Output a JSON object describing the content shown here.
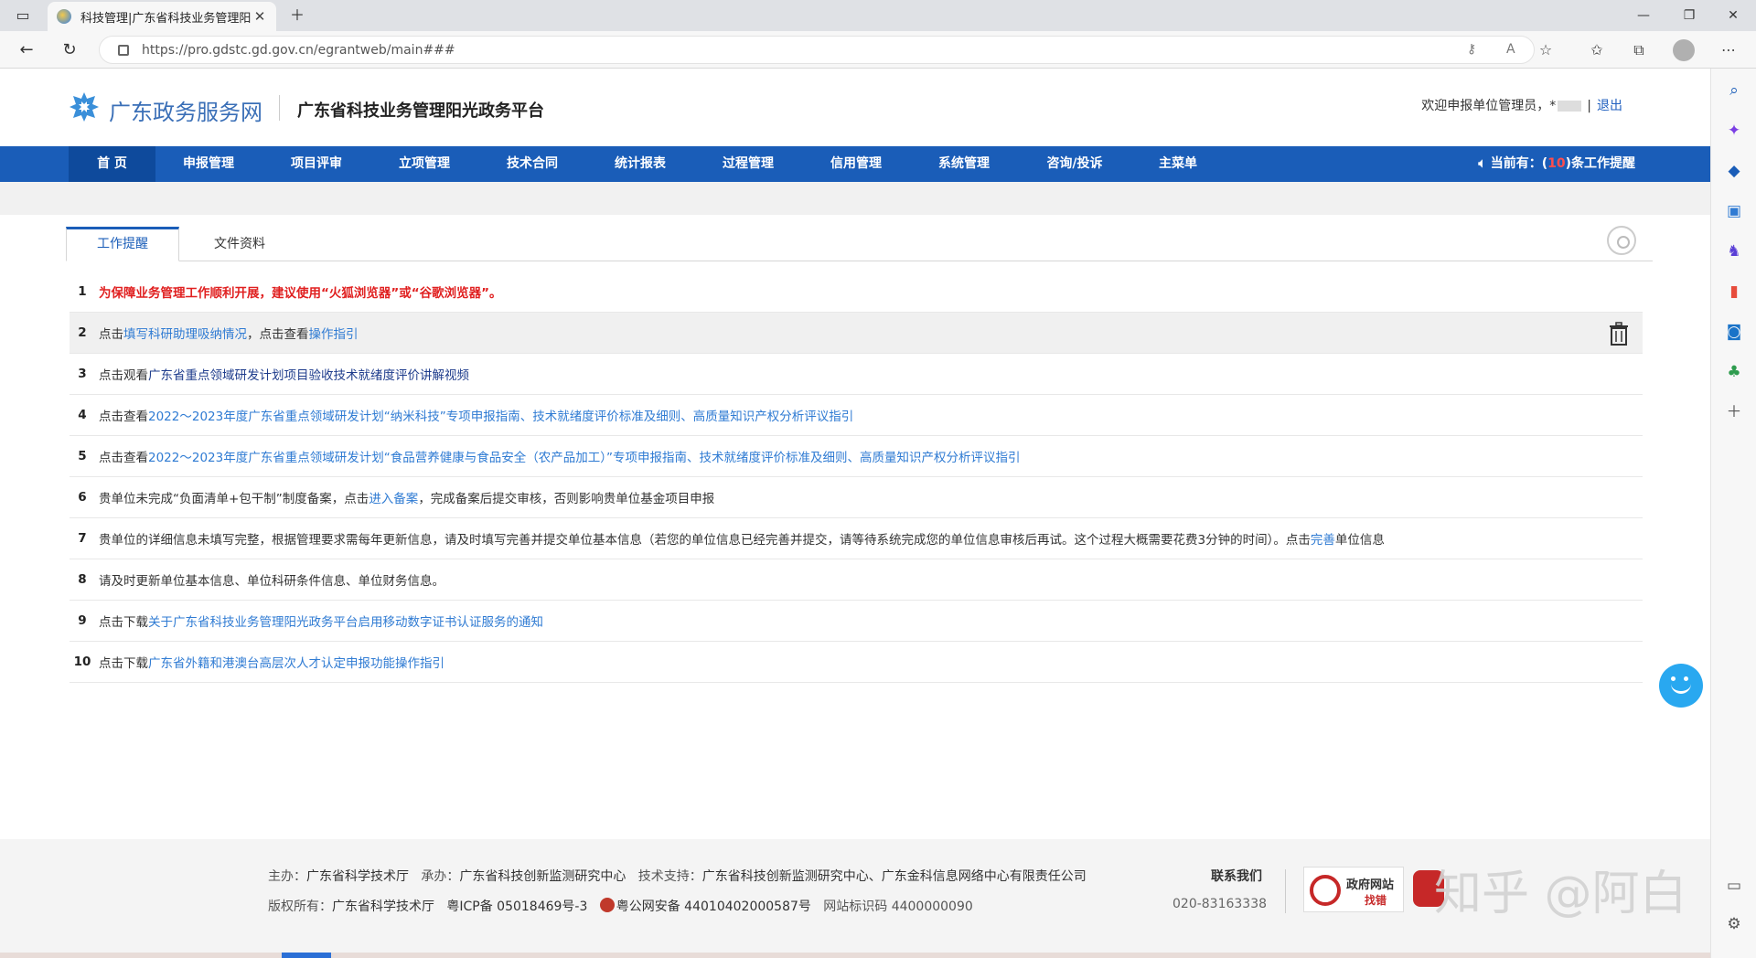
{
  "browser": {
    "tab_title": "科技管理|广东省科技业务管理阳",
    "url": "https://pro.gdstc.gd.gov.cn/egrantweb/main###"
  },
  "header": {
    "gov_logo_text": "广东政务服务网",
    "platform_title": "广东省科技业务管理阳光政务平台",
    "welcome_text": "欢迎申报单位管理员，",
    "user_mask_prefix": "*",
    "logout_label": "退出"
  },
  "nav": {
    "items": [
      "首 页",
      "申报管理",
      "项目评审",
      "立项管理",
      "技术合同",
      "统计报表",
      "过程管理",
      "信用管理",
      "系统管理",
      "咨询/投诉",
      "主菜单"
    ],
    "reminder_prefix": "当前有：(",
    "reminder_count": "10",
    "reminder_suffix": ")条工作提醒"
  },
  "page_tabs": [
    "工作提醒",
    "文件资料"
  ],
  "reminders": [
    {
      "num": "1",
      "parts": [
        {
          "t": "为保障业务管理工作顺利开展，建议使用“火狐浏览器”或“谷歌浏览器”。",
          "s": "warn"
        }
      ]
    },
    {
      "num": "2",
      "parts": [
        {
          "t": "点击",
          "s": ""
        },
        {
          "t": "填写科研助理吸纳情况",
          "s": "link"
        },
        {
          "t": "，点击查看",
          "s": ""
        },
        {
          "t": "操作指引",
          "s": "link"
        }
      ]
    },
    {
      "num": "3",
      "parts": [
        {
          "t": "点击观看",
          "s": ""
        },
        {
          "t": "广东省重点领域研发计划项目验收技术就绪度评价讲解视频",
          "s": "dark"
        }
      ]
    },
    {
      "num": "4",
      "parts": [
        {
          "t": "点击查看",
          "s": ""
        },
        {
          "t": "2022～2023年度广东省重点领域研发计划“纳米科技”专项申报指南",
          "s": "link"
        },
        {
          "t": "、",
          "s": "link"
        },
        {
          "t": "技术就绪度评价标准及细则",
          "s": "link"
        },
        {
          "t": "、",
          "s": "link"
        },
        {
          "t": "高质量知识产权分析评议指引",
          "s": "link"
        }
      ]
    },
    {
      "num": "5",
      "parts": [
        {
          "t": "点击查看",
          "s": ""
        },
        {
          "t": "2022～2023年度广东省重点领域研发计划“食品营养健康与食品安全（农产品加工）”专项申报指南",
          "s": "link"
        },
        {
          "t": "、",
          "s": "link"
        },
        {
          "t": "技术就绪度评价标准及细则",
          "s": "link"
        },
        {
          "t": "、",
          "s": "link"
        },
        {
          "t": "高质量知识产权分析评议指引",
          "s": "link"
        }
      ]
    },
    {
      "num": "6",
      "parts": [
        {
          "t": "贵单位未完成“负面清单+包干制”制度备案，点击",
          "s": ""
        },
        {
          "t": "进入备案",
          "s": "link"
        },
        {
          "t": "，完成备案后提交审核，否则影响贵单位基金项目申报",
          "s": ""
        }
      ]
    },
    {
      "num": "7",
      "parts": [
        {
          "t": "贵单位的详细信息未填写完整，根据管理要求需每年更新信息，请及时填写完善并提交单位基本信息（若您的单位信息已经完善并提交，请等待系统完成您的单位信息审核后再试。这个过程大概需要花费3分钟的时间）。点击",
          "s": ""
        },
        {
          "t": "完善",
          "s": "link"
        },
        {
          "t": "单位信息",
          "s": ""
        }
      ]
    },
    {
      "num": "8",
      "parts": [
        {
          "t": "请及时更新单位基本信息、单位科研条件信息、单位财务信息。",
          "s": ""
        }
      ]
    },
    {
      "num": "9",
      "parts": [
        {
          "t": "点击下载",
          "s": ""
        },
        {
          "t": "关于广东省科技业务管理阳光政务平台启用移动数字证书认证服务的通知",
          "s": "link"
        }
      ]
    },
    {
      "num": "10",
      "parts": [
        {
          "t": "点击下载",
          "s": ""
        },
        {
          "t": "广东省外籍和港澳台高层次人才认定申报功能操作指引",
          "s": "link"
        }
      ]
    }
  ],
  "footer": {
    "host_label": "主办：",
    "host": "广东省科学技术厅",
    "undertaker_label": "承办：",
    "undertaker": "广东省科技创新监测研究中心",
    "support_label": "技术支持：",
    "support": "广东省科技创新监测研究中心、广东金科信息网络中心有限责任公司",
    "copyright_label": "版权所有：",
    "copyright": "广东省科学技术厅",
    "icp": "粤ICP备 05018469号-3",
    "police": "粤公网安备 44010402000587号",
    "site_code": "网站标识码 4400000090",
    "contact_title": "联系我们",
    "contact_phone": "020-83163338",
    "gov_badge_top": "政府网站",
    "gov_badge_bottom": "找错"
  },
  "watermark": "知乎 @阿白",
  "colors": {
    "nav_blue": "#1a5db8",
    "link": "#2f7bd3",
    "warn": "#e02020"
  }
}
